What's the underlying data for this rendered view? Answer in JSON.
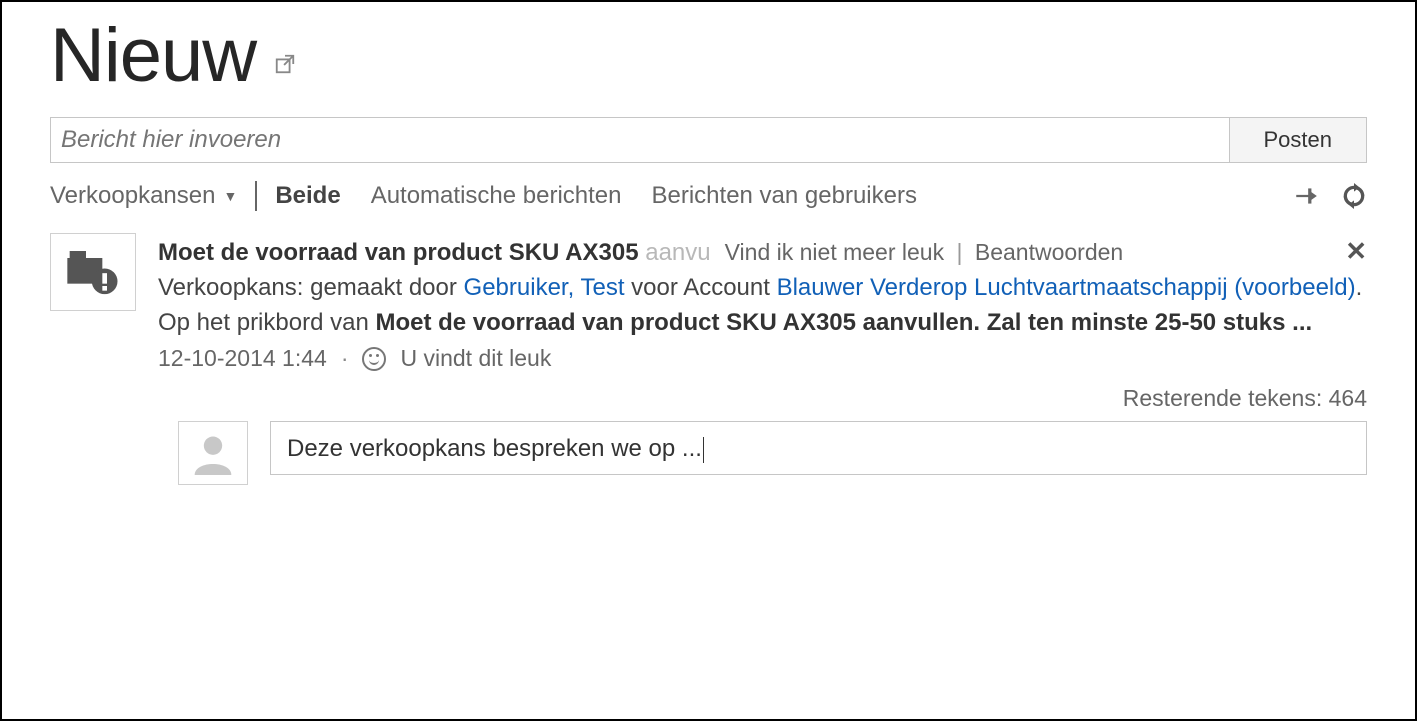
{
  "page": {
    "title": "Nieuw"
  },
  "compose": {
    "placeholder": "Bericht hier invoeren",
    "post_label": "Posten"
  },
  "filters": {
    "dropdown_label": "Verkoopkansen",
    "tabs": {
      "both": "Beide",
      "auto": "Automatische berichten",
      "user": "Berichten van gebruikers"
    }
  },
  "post": {
    "title": "Moet de voorraad van product SKU AX305",
    "title_truncated": "aanvu",
    "action_unlike": "Vind ik niet meer leuk",
    "action_reply": "Beantwoorden",
    "line2_prefix": "Verkoopkans: gemaakt door ",
    "user_link": "Gebruiker, Test",
    "line2_mid": " voor Account ",
    "account_link": "Blauwer Verderop Luchtvaartmaatschappij (voorbeeld)",
    "line2_suffix": ".",
    "wall_prefix": "Op het prikbord van ",
    "wall_bold": "Moet de voorraad van product SKU AX305 aanvullen. Zal ten minste 25-50 stuks ...",
    "timestamp": "12-10-2014 1:44",
    "like_status": "U vindt dit leuk",
    "remaining_label": "Resterende tekens: ",
    "remaining_count": "464",
    "reply_value": "Deze verkoopkans bespreken we op ..."
  }
}
